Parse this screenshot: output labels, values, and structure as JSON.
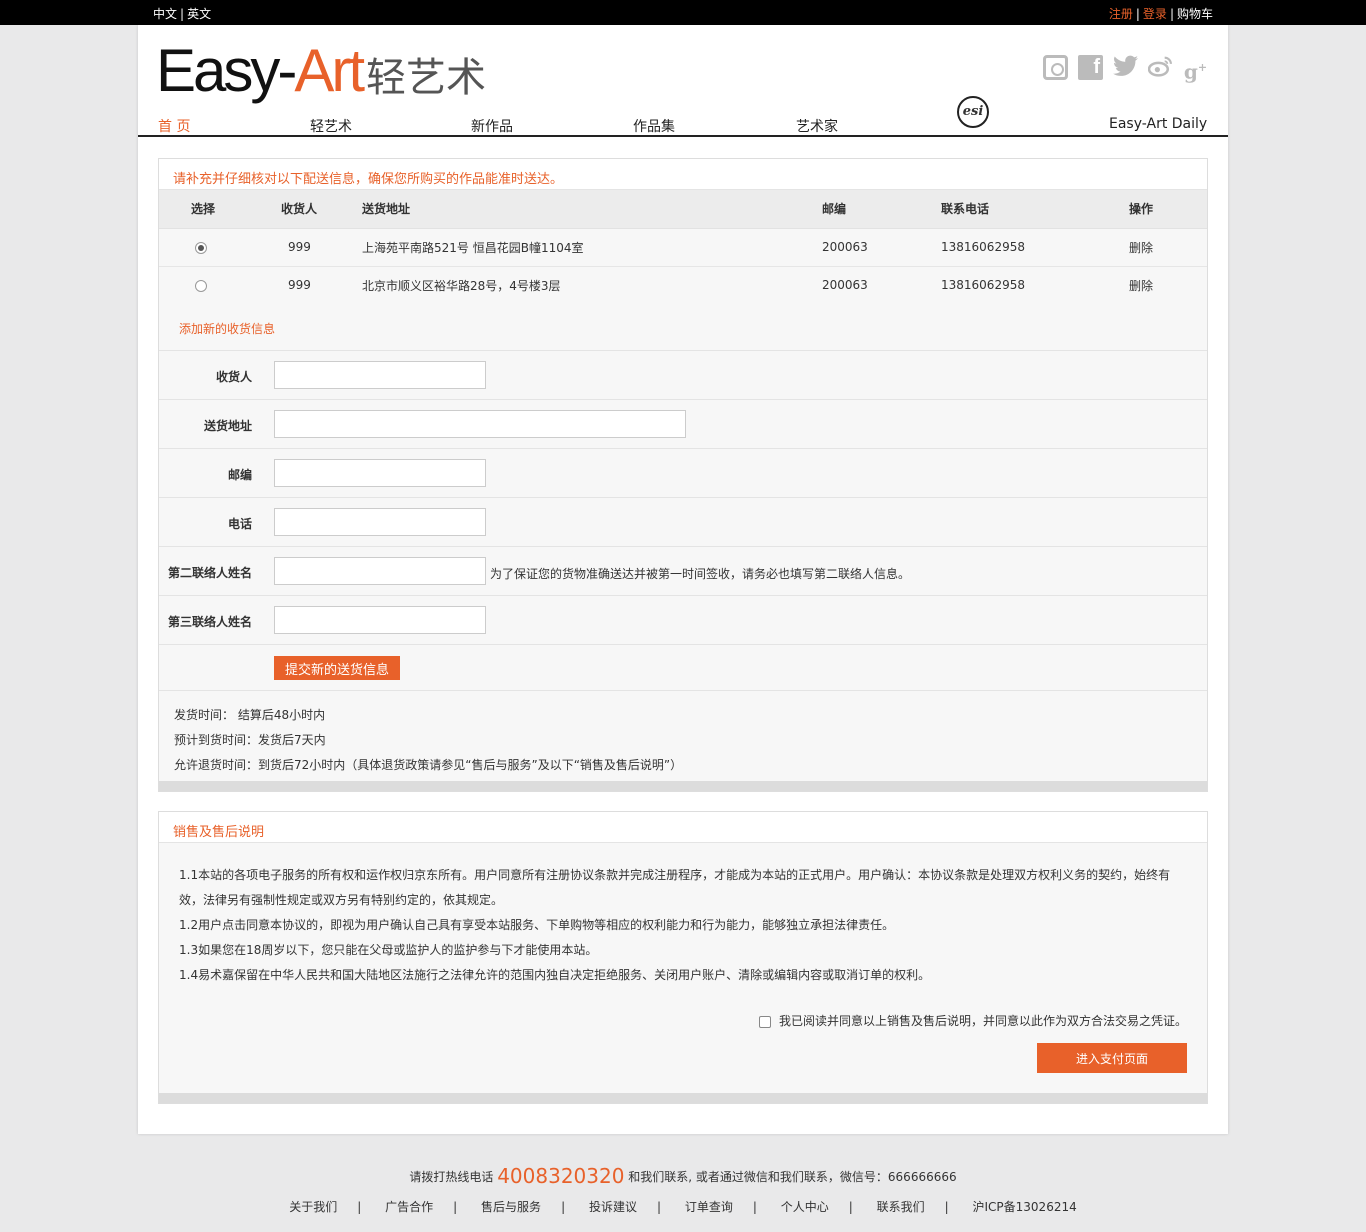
{
  "topbar": {
    "lang_cn": "中文",
    "lang_en": "英文",
    "register": "注册",
    "login": "登录",
    "cart": "购物车"
  },
  "logo": {
    "part1": "Easy-",
    "part2": "Art",
    "cn": "轻艺术"
  },
  "nav": {
    "items": [
      {
        "label": "首 页",
        "active": true
      },
      {
        "label": "轻艺术"
      },
      {
        "label": "新作品"
      },
      {
        "label": "作品集"
      },
      {
        "label": "艺术家"
      },
      {
        "label": "Easy-Art Daily"
      }
    ],
    "esi_label": "esi"
  },
  "shipping": {
    "title": "请补充并仔细核对以下配送信息，确保您所购买的作品能准时送达。",
    "headers": [
      "选择",
      "收货人",
      "送货地址",
      "邮编",
      "联系电话",
      "操作"
    ],
    "rows": [
      {
        "selected": true,
        "name": "999",
        "address": "上海苑平南路521号 恒昌花园B幢1104室",
        "zip": "200063",
        "phone": "13816062958",
        "action": "删除"
      },
      {
        "selected": false,
        "name": "999",
        "address": "北京市顺义区裕华路28号，4号楼3层",
        "zip": "200063",
        "phone": "13816062958",
        "action": "删除"
      }
    ],
    "add_new": "添加新的收货信息",
    "form": {
      "receiver": "收货人",
      "address": "送货地址",
      "zip": "邮编",
      "phone": "电话",
      "contact2": "第二联络人姓名",
      "contact2_note": "为了保证您的货物准确送达并被第一时间签收，请务必也填写第二联络人信息。",
      "contact3": "第三联络人姓名",
      "submit": "提交新的送货信息"
    },
    "info": {
      "ship_time": "发货时间： 结算后48小时内",
      "arrive_time": "预计到货时间：发货后7天内",
      "return_time": "允许退货时间：到货后72小时内（具体退货政策请参见“售后与服务”及以下“销售及售后说明”）"
    }
  },
  "terms": {
    "title": "销售及售后说明",
    "p1": "1.1本站的各项电子服务的所有权和运作权归京东所有。用户同意所有注册协议条款并完成注册程序，才能成为本站的正式用户。用户确认：本协议条款是处理双方权利义务的契约，始终有效，法律另有强制性规定或双方另有特别约定的，依其规定。",
    "p2": "1.2用户点击同意本协议的，即视为用户确认自己具有享受本站服务、下单购物等相应的权利能力和行为能力，能够独立承担法律责任。",
    "p3": "1.3如果您在18周岁以下，您只能在父母或监护人的监护参与下才能使用本站。",
    "p4": "1.4易术嘉保留在中华人民共和国大陆地区法施行之法律允许的范围内独自决定拒绝服务、关闭用户账户、清除或编辑内容或取消订单的权利。",
    "agree": "我已阅读并同意以上销售及售后说明，并同意以此作为双方合法交易之凭证。",
    "pay_button": "进入支付页面"
  },
  "footer": {
    "hotline_pre": "请拨打热线电话",
    "hotline": "4008320320",
    "hotline_post": "和我们联系, 或者通过微信和我们联系，微信号：666666666",
    "links": [
      "关于我们",
      "广告合作",
      "售后与服务",
      "投诉建议",
      "订单查询",
      "个人中心",
      "联系我们",
      "沪ICP备13026214"
    ]
  },
  "colors": {
    "accent": "#e8612a"
  }
}
